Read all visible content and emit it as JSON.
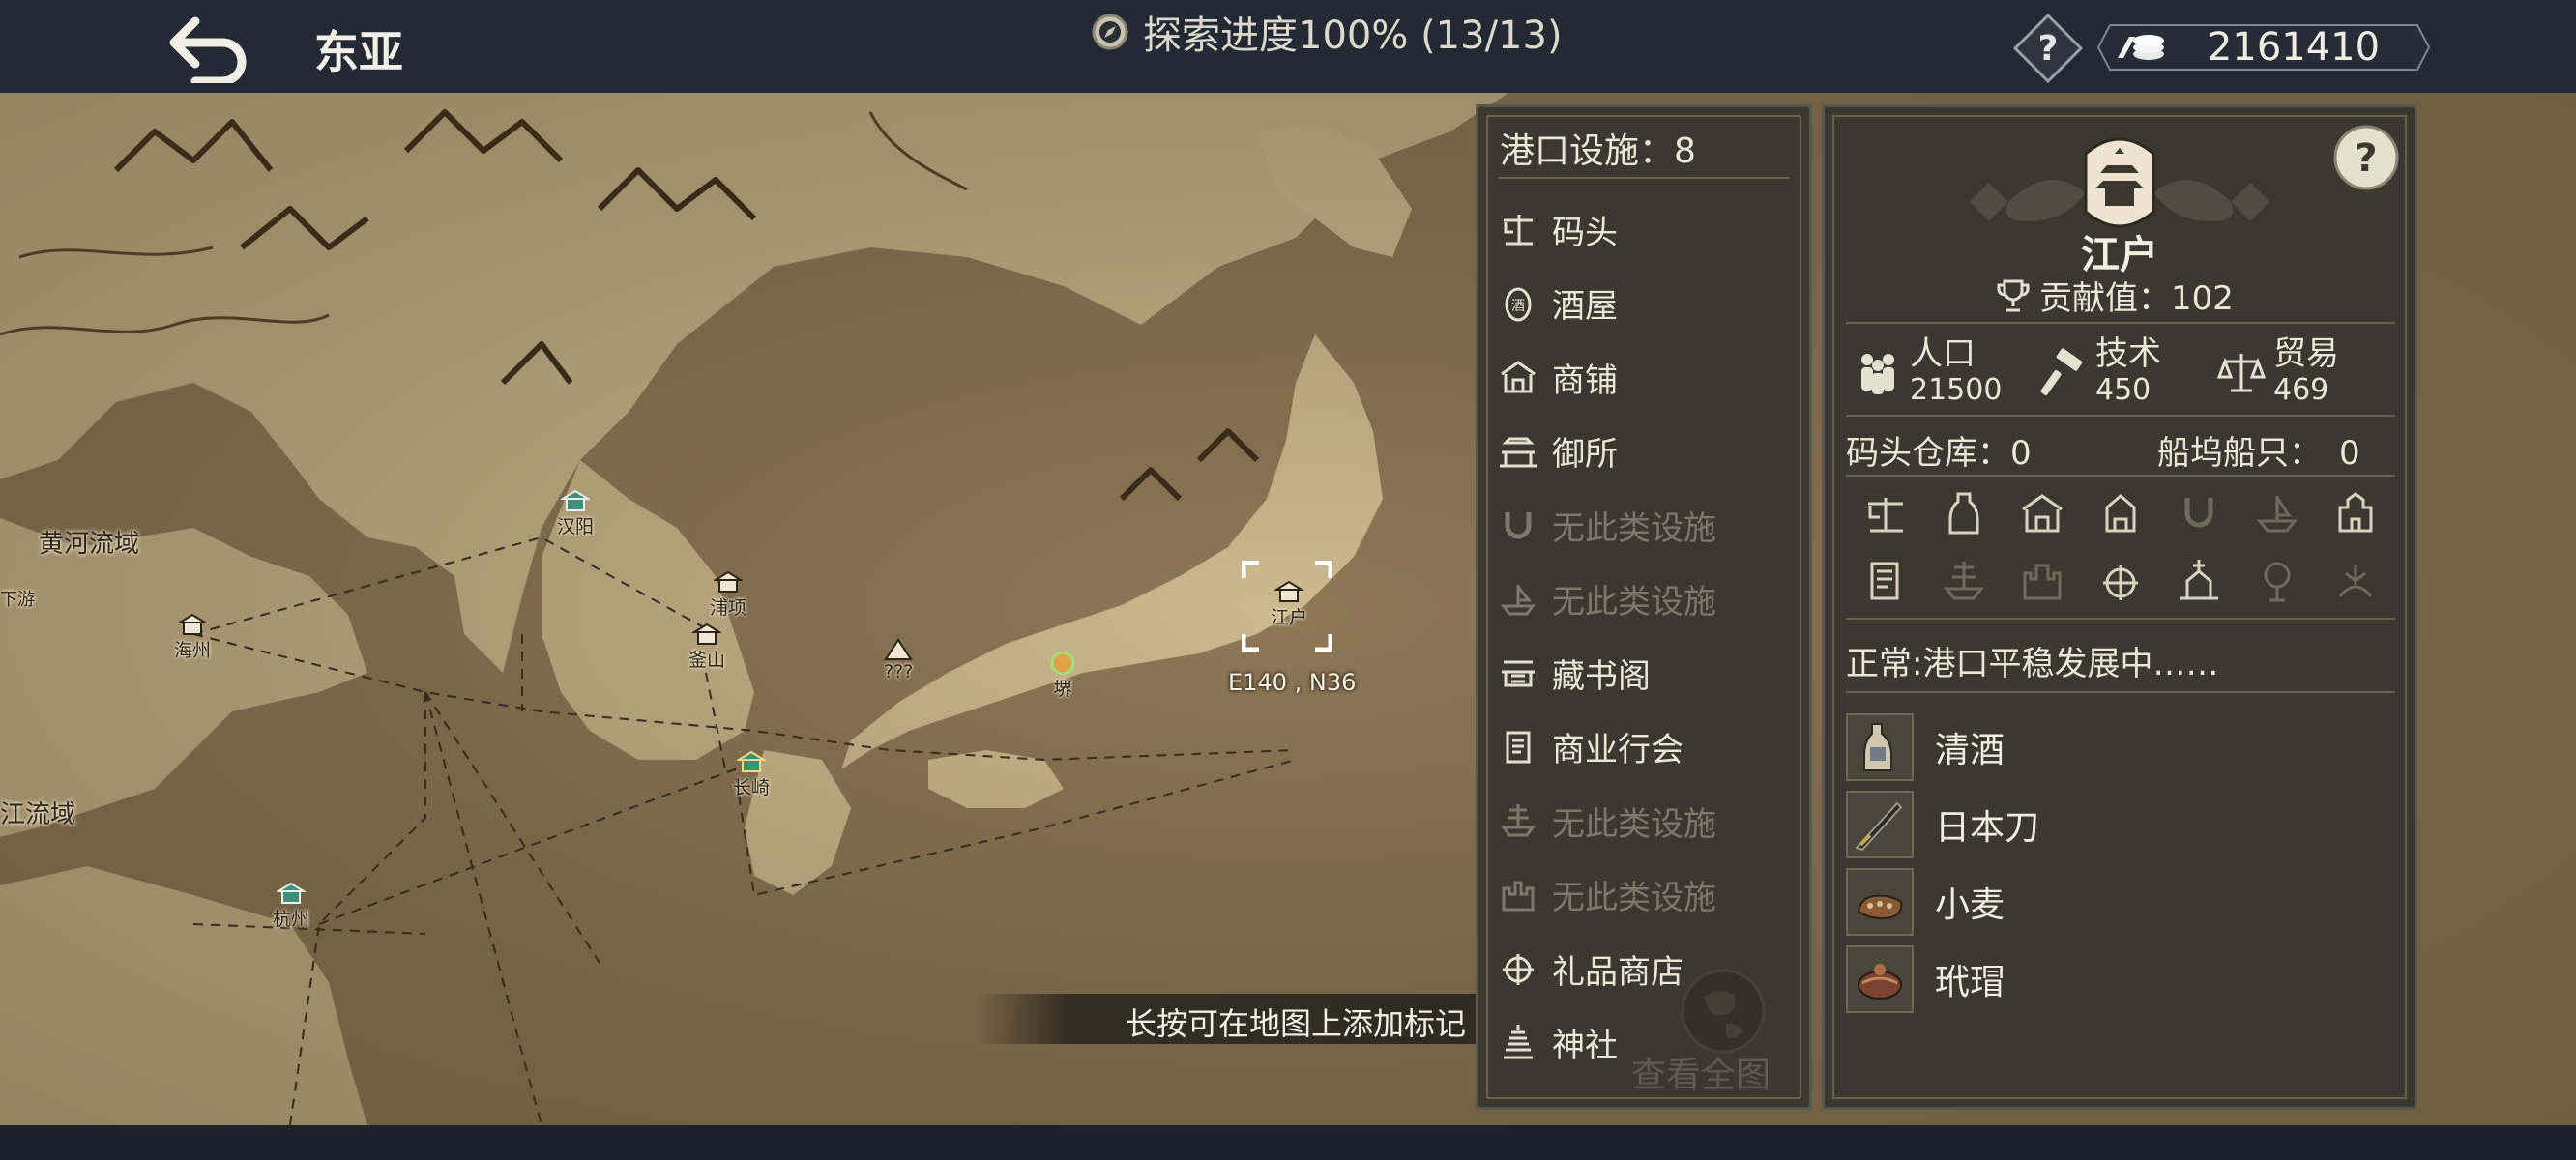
{
  "topbar": {
    "region_title": "东亚",
    "progress_text": "探索进度100% (13/13)",
    "coins": "2161410"
  },
  "map": {
    "regions": [
      {
        "name": "黄河流域"
      },
      {
        "name": "江流域"
      },
      {
        "name": "下游"
      }
    ],
    "cities": [
      {
        "name": "汉阳"
      },
      {
        "name": "海州"
      },
      {
        "name": "浦项"
      },
      {
        "name": "釜山"
      },
      {
        "name": "???"
      },
      {
        "name": "堺"
      },
      {
        "name": "江户"
      },
      {
        "name": "长崎"
      },
      {
        "name": "杭州"
      }
    ],
    "selected_coords": "E140 , N36",
    "hint": "长按可在地图上添加标记"
  },
  "facilities": {
    "header": "港口设施：8",
    "items": [
      {
        "label": "码头",
        "available": true,
        "icon": "dock-icon"
      },
      {
        "label": "酒屋",
        "available": true,
        "icon": "tavern-icon"
      },
      {
        "label": "商铺",
        "available": true,
        "icon": "shop-icon"
      },
      {
        "label": "御所",
        "available": true,
        "icon": "palace-icon"
      },
      {
        "label": "无此类设施",
        "available": false,
        "icon": "horseshoe-icon"
      },
      {
        "label": "无此类设施",
        "available": false,
        "icon": "shipyard-icon"
      },
      {
        "label": "藏书阁",
        "available": true,
        "icon": "library-icon"
      },
      {
        "label": "商业行会",
        "available": true,
        "icon": "guild-icon"
      },
      {
        "label": "无此类设施",
        "available": false,
        "icon": "ship-icon"
      },
      {
        "label": "无此类设施",
        "available": false,
        "icon": "castle-icon"
      },
      {
        "label": "礼品商店",
        "available": true,
        "icon": "gift-shop-icon"
      },
      {
        "label": "神社",
        "available": true,
        "icon": "shrine-icon"
      }
    ],
    "view_all": "查看全图"
  },
  "port": {
    "name": "江户",
    "contribution": "贡献值：102",
    "population_label": "人口",
    "population": "21500",
    "tech_label": "技术",
    "tech": "450",
    "trade_label": "贸易",
    "trade": "469",
    "warehouse": "码头仓库：0",
    "ships_label": "船坞船只：",
    "ships": "0",
    "status": "正常:港口平稳发展中……",
    "goods": [
      {
        "name": "清酒",
        "icon": "sake-icon"
      },
      {
        "name": "日本刀",
        "icon": "katana-icon"
      },
      {
        "name": "小麦",
        "icon": "wheat-icon"
      },
      {
        "name": "玳瑁",
        "icon": "tortoiseshell-icon"
      }
    ]
  },
  "colors": {
    "panel_bg": "#3a3830",
    "panel_border": "#5a574c",
    "topbar_bg": "#232a33",
    "map_land": "#c9b58c",
    "map_sea": "#8d7654",
    "dim_text": "#7d786a"
  }
}
